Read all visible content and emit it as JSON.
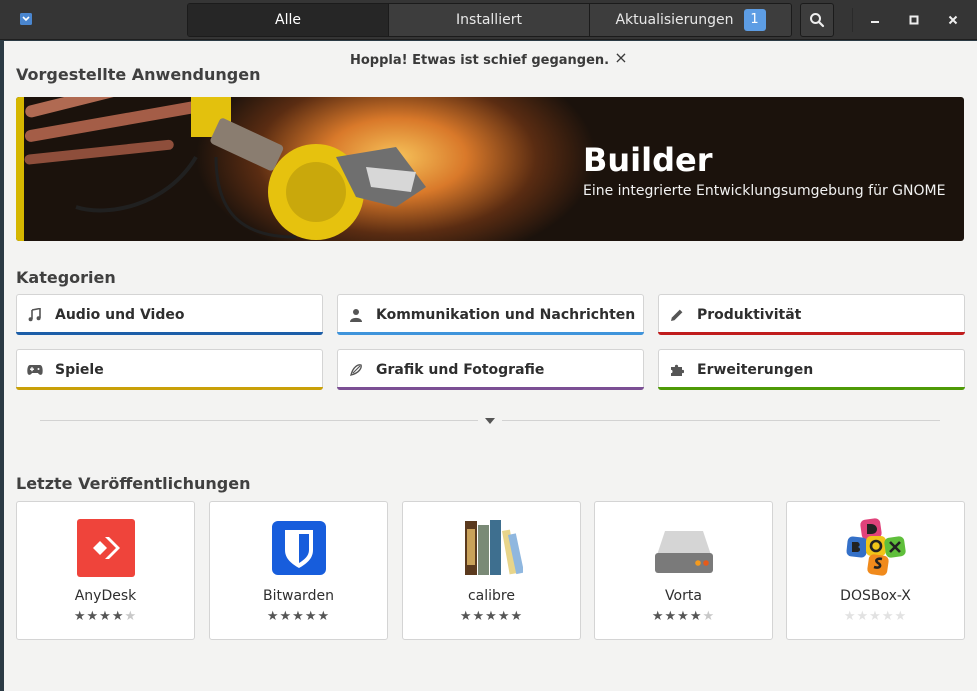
{
  "header": {
    "tabs": [
      {
        "label": "Alle",
        "active": true
      },
      {
        "label": "Installiert",
        "active": false
      },
      {
        "label": "Aktualisierungen",
        "active": false,
        "badge": "1"
      }
    ],
    "search_icon": "search-icon",
    "window_controls": [
      "minimize-icon",
      "maximize-icon",
      "close-icon"
    ]
  },
  "notification": {
    "text": "Hoppla! Etwas ist schief gegangen.",
    "close": "×"
  },
  "featured": {
    "section_title": "Vorgestellte Anwendungen",
    "title": "Builder",
    "subtitle": "Eine integrierte Entwicklungsumgebung für GNOME"
  },
  "categories": {
    "section_title": "Kategorien",
    "items": [
      {
        "label": "Audio und Video",
        "icon": "music-note-icon",
        "color": "#1c5ea8"
      },
      {
        "label": "Kommunikation und Nachrichten",
        "icon": "person-icon",
        "color": "#3f94db"
      },
      {
        "label": "Produktivität",
        "icon": "pencil-icon",
        "color": "#c01c1c"
      },
      {
        "label": "Spiele",
        "icon": "gamepad-icon",
        "color": "#c9a008"
      },
      {
        "label": "Grafik und Fotografie",
        "icon": "brush-icon",
        "color": "#7b4f94"
      },
      {
        "label": "Erweiterungen",
        "icon": "puzzle-icon",
        "color": "#4e9a06"
      }
    ]
  },
  "recent": {
    "section_title": "Letzte Veröffentlichungen",
    "apps": [
      {
        "name": "AnyDesk",
        "rating": 4
      },
      {
        "name": "Bitwarden",
        "rating": 5
      },
      {
        "name": "calibre",
        "rating": 5
      },
      {
        "name": "Vorta",
        "rating": 4
      },
      {
        "name": "DOSBox-X",
        "rating": 0
      }
    ]
  },
  "colors": {
    "anydesk": "#ef443b",
    "bitwarden": "#175ddc",
    "vorta": "#7a7a7a"
  }
}
